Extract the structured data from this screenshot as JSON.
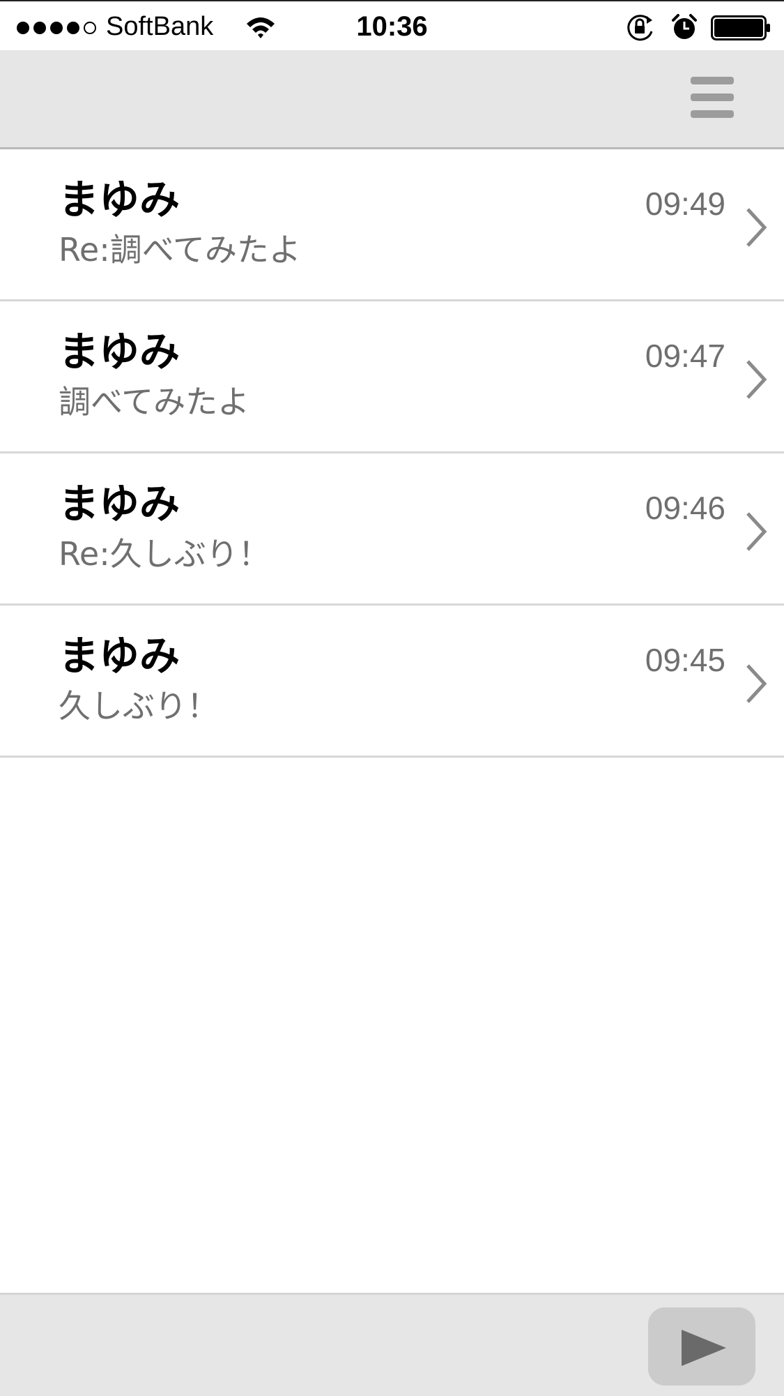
{
  "status_bar": {
    "carrier": "SoftBank",
    "time": "10:36",
    "signal_bars_filled": 4,
    "signal_bars_total": 5,
    "icons": [
      "wifi-icon",
      "lock-rotation-icon",
      "alarm-icon",
      "battery-icon"
    ]
  },
  "nav_bar": {
    "menu_icon": "hamburger-menu-icon"
  },
  "messages": [
    {
      "sender": "まゆみ",
      "subject": "Re:調べてみたよ",
      "time": "09:49"
    },
    {
      "sender": "まゆみ",
      "subject": "調べてみたよ",
      "time": "09:47"
    },
    {
      "sender": "まゆみ",
      "subject": "Re:久しぶり！",
      "time": "09:46"
    },
    {
      "sender": "まゆみ",
      "subject": "久しぶり！",
      "time": "09:45"
    }
  ],
  "toolbar": {
    "play_icon": "play-icon"
  },
  "colors": {
    "bar_background": "#e6e6e6",
    "secondary_text": "#6f6f6f",
    "divider": "#d7d7d7"
  }
}
